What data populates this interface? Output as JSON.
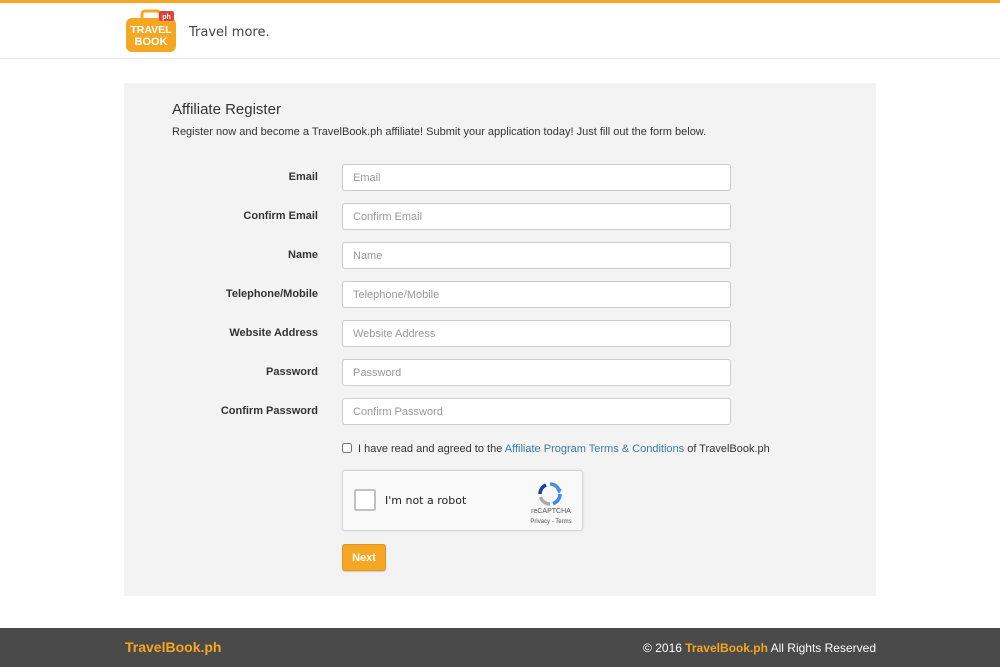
{
  "header": {
    "logo_text_top": "TRAVEL",
    "logo_text_bottom": "BOOK",
    "logo_badge": "ph",
    "tagline": "Travel more."
  },
  "form": {
    "title": "Affiliate Register",
    "subtitle": "Register now and become a TravelBook.ph affiliate! Submit your application today! Just fill out the form below.",
    "fields": [
      {
        "label": "Email",
        "placeholder": "Email",
        "value": ""
      },
      {
        "label": "Confirm Email",
        "placeholder": "Confirm Email",
        "value": ""
      },
      {
        "label": "Name",
        "placeholder": "Name",
        "value": ""
      },
      {
        "label": "Telephone/Mobile",
        "placeholder": "Telephone/Mobile",
        "value": ""
      },
      {
        "label": "Website Address",
        "placeholder": "Website Address",
        "value": ""
      },
      {
        "label": "Password",
        "placeholder": "Password",
        "value": ""
      },
      {
        "label": "Confirm Password",
        "placeholder": "Confirm Password",
        "value": ""
      }
    ],
    "agree_prefix": "I have read and agreed to the",
    "agree_link": "Affiliate Program Terms & Conditions",
    "agree_suffix": "of TravelBook.ph",
    "agree_checked": false,
    "captcha": {
      "label": "I'm not a robot",
      "brand": "reCAPTCHA",
      "terms": "Privacy - Terms"
    },
    "next_label": "Next"
  },
  "footer": {
    "brand": "TravelBook.ph",
    "copy_prefix": "© 2016",
    "copy_brand": "TravelBook.ph",
    "copy_suffix": "All Rights Reserved"
  },
  "colors": {
    "accent": "#f5a623",
    "footer_bg": "#4a4a4a",
    "panel_bg": "#f3f3f3",
    "link": "#3a7ca5"
  }
}
